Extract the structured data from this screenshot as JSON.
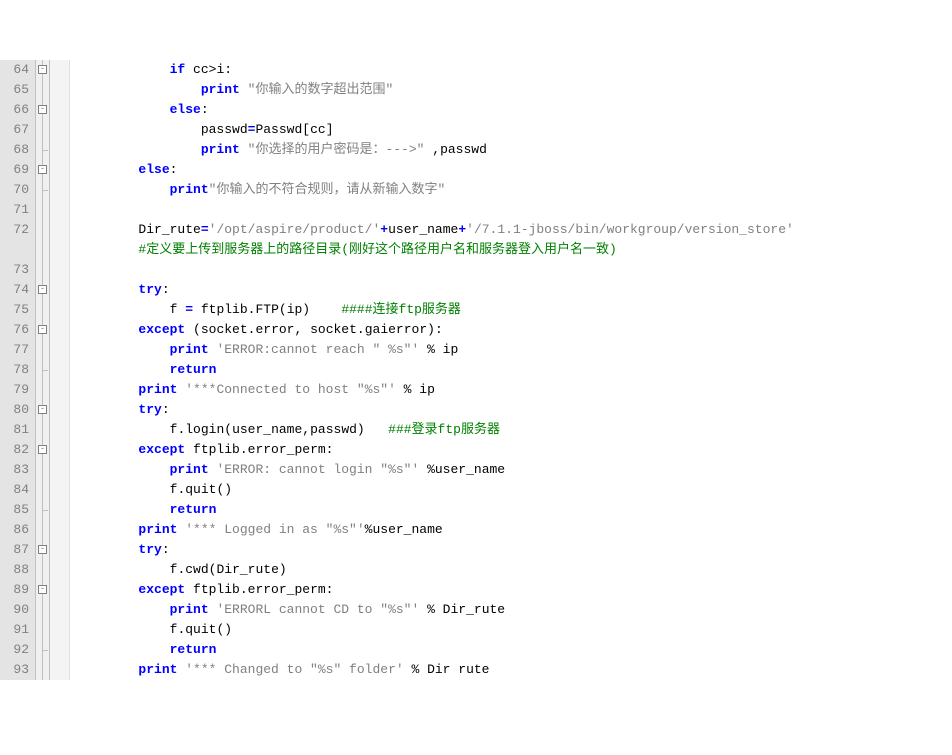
{
  "lines": [
    {
      "num": "64",
      "fold": "start",
      "indent": "            ",
      "tokens": [
        {
          "t": "if ",
          "c": "kw"
        },
        {
          "t": "cc",
          "c": "ident"
        },
        {
          "t": ">",
          "c": "ident"
        },
        {
          "t": "i",
          "c": "ident"
        },
        {
          "t": ":",
          "c": "ident"
        }
      ]
    },
    {
      "num": "65",
      "fold": "line",
      "indent": "                ",
      "tokens": [
        {
          "t": "print ",
          "c": "kw"
        },
        {
          "t": "\"你输入的数字超出范围\"",
          "c": "str"
        }
      ]
    },
    {
      "num": "66",
      "fold": "start",
      "indent": "            ",
      "tokens": [
        {
          "t": "else",
          "c": "kw"
        },
        {
          "t": ":",
          "c": "ident"
        }
      ]
    },
    {
      "num": "67",
      "fold": "line",
      "indent": "                ",
      "tokens": [
        {
          "t": "passwd",
          "c": "ident"
        },
        {
          "t": "=",
          "c": "kw"
        },
        {
          "t": "Passwd",
          "c": "ident"
        },
        {
          "t": "[",
          "c": "ident"
        },
        {
          "t": "cc",
          "c": "ident"
        },
        {
          "t": "]",
          "c": "ident"
        }
      ]
    },
    {
      "num": "68",
      "fold": "end",
      "indent": "                ",
      "tokens": [
        {
          "t": "print ",
          "c": "kw"
        },
        {
          "t": "\"你选择的用户密码是：--->\" ",
          "c": "str"
        },
        {
          "t": ",",
          "c": "ident"
        },
        {
          "t": "passwd",
          "c": "ident"
        }
      ]
    },
    {
      "num": "69",
      "fold": "start",
      "indent": "        ",
      "tokens": [
        {
          "t": "else",
          "c": "kw"
        },
        {
          "t": ":",
          "c": "ident"
        }
      ]
    },
    {
      "num": "70",
      "fold": "end",
      "indent": "            ",
      "tokens": [
        {
          "t": "print",
          "c": "kw"
        },
        {
          "t": "\"你输入的不符合规则，请从新输入数字\"",
          "c": "str"
        }
      ]
    },
    {
      "num": "71",
      "fold": "line",
      "indent": "",
      "tokens": []
    },
    {
      "num": "72",
      "fold": "line",
      "indent": "        ",
      "tokens": [
        {
          "t": "Dir_rute",
          "c": "ident"
        },
        {
          "t": "=",
          "c": "kw"
        },
        {
          "t": "'/opt/aspire/product/'",
          "c": "str"
        },
        {
          "t": "+",
          "c": "kw"
        },
        {
          "t": "user_name",
          "c": "ident"
        },
        {
          "t": "+",
          "c": "kw"
        },
        {
          "t": "'/7.1.1-jboss/bin/workgroup/version_store'",
          "c": "str"
        }
      ]
    },
    {
      "num": "",
      "fold": "line",
      "indent": "        ",
      "tokens": [
        {
          "t": "#定义要上传到服务器上的路径目录(刚好这个路径用户名和服务器登入用户名一致)",
          "c": "comment"
        }
      ]
    },
    {
      "num": "73",
      "fold": "line",
      "indent": "",
      "tokens": []
    },
    {
      "num": "74",
      "fold": "start",
      "indent": "        ",
      "tokens": [
        {
          "t": "try",
          "c": "kw"
        },
        {
          "t": ":",
          "c": "ident"
        }
      ]
    },
    {
      "num": "75",
      "fold": "line",
      "indent": "            ",
      "tokens": [
        {
          "t": "f ",
          "c": "ident"
        },
        {
          "t": "=",
          "c": "kw"
        },
        {
          "t": " ftplib",
          "c": "ident"
        },
        {
          "t": ".",
          "c": "ident"
        },
        {
          "t": "FTP",
          "c": "ident"
        },
        {
          "t": "(",
          "c": "ident"
        },
        {
          "t": "ip",
          "c": "ident"
        },
        {
          "t": ")",
          "c": "ident"
        },
        {
          "t": "    ",
          "c": "ident"
        },
        {
          "t": "####连接ftp服务器",
          "c": "comment"
        }
      ]
    },
    {
      "num": "76",
      "fold": "start",
      "indent": "        ",
      "tokens": [
        {
          "t": "except ",
          "c": "kw"
        },
        {
          "t": "(",
          "c": "ident"
        },
        {
          "t": "socket",
          "c": "ident"
        },
        {
          "t": ".",
          "c": "ident"
        },
        {
          "t": "error",
          "c": "ident"
        },
        {
          "t": ",",
          "c": "ident"
        },
        {
          "t": " socket",
          "c": "ident"
        },
        {
          "t": ".",
          "c": "ident"
        },
        {
          "t": "gaierror",
          "c": "ident"
        },
        {
          "t": ")",
          "c": "ident"
        },
        {
          "t": ":",
          "c": "ident"
        }
      ]
    },
    {
      "num": "77",
      "fold": "line",
      "indent": "            ",
      "tokens": [
        {
          "t": "print ",
          "c": "kw"
        },
        {
          "t": "'ERROR:cannot reach \" %s\"'",
          "c": "str"
        },
        {
          "t": " % ip",
          "c": "ident"
        }
      ]
    },
    {
      "num": "78",
      "fold": "end",
      "indent": "            ",
      "tokens": [
        {
          "t": "return",
          "c": "kw"
        }
      ]
    },
    {
      "num": "79",
      "fold": "line",
      "indent": "        ",
      "tokens": [
        {
          "t": "print ",
          "c": "kw"
        },
        {
          "t": "'***Connected to host \"%s\"'",
          "c": "str"
        },
        {
          "t": " % ip",
          "c": "ident"
        }
      ]
    },
    {
      "num": "80",
      "fold": "start",
      "indent": "        ",
      "tokens": [
        {
          "t": "try",
          "c": "kw"
        },
        {
          "t": ":",
          "c": "ident"
        }
      ]
    },
    {
      "num": "81",
      "fold": "line",
      "indent": "            ",
      "tokens": [
        {
          "t": "f",
          "c": "ident"
        },
        {
          "t": ".",
          "c": "ident"
        },
        {
          "t": "login",
          "c": "ident"
        },
        {
          "t": "(",
          "c": "ident"
        },
        {
          "t": "user_name",
          "c": "ident"
        },
        {
          "t": ",",
          "c": "ident"
        },
        {
          "t": "passwd",
          "c": "ident"
        },
        {
          "t": ")",
          "c": "ident"
        },
        {
          "t": "   ",
          "c": "ident"
        },
        {
          "t": "###登录ftp服务器",
          "c": "comment"
        }
      ]
    },
    {
      "num": "82",
      "fold": "start",
      "indent": "        ",
      "tokens": [
        {
          "t": "except ",
          "c": "kw"
        },
        {
          "t": "ftplib",
          "c": "ident"
        },
        {
          "t": ".",
          "c": "ident"
        },
        {
          "t": "error_perm",
          "c": "ident"
        },
        {
          "t": ":",
          "c": "ident"
        }
      ]
    },
    {
      "num": "83",
      "fold": "line",
      "indent": "            ",
      "tokens": [
        {
          "t": "print ",
          "c": "kw"
        },
        {
          "t": "'ERROR: cannot login \"%s\"'",
          "c": "str"
        },
        {
          "t": " %user_name",
          "c": "ident"
        }
      ]
    },
    {
      "num": "84",
      "fold": "line",
      "indent": "            ",
      "tokens": [
        {
          "t": "f",
          "c": "ident"
        },
        {
          "t": ".",
          "c": "ident"
        },
        {
          "t": "quit",
          "c": "ident"
        },
        {
          "t": "()",
          "c": "ident"
        }
      ]
    },
    {
      "num": "85",
      "fold": "end",
      "indent": "            ",
      "tokens": [
        {
          "t": "return",
          "c": "kw"
        }
      ]
    },
    {
      "num": "86",
      "fold": "line",
      "indent": "        ",
      "tokens": [
        {
          "t": "print ",
          "c": "kw"
        },
        {
          "t": "'*** Logged in as \"%s\"'",
          "c": "str"
        },
        {
          "t": "%user_name",
          "c": "ident"
        }
      ]
    },
    {
      "num": "87",
      "fold": "start",
      "indent": "        ",
      "tokens": [
        {
          "t": "try",
          "c": "kw"
        },
        {
          "t": ":",
          "c": "ident"
        }
      ]
    },
    {
      "num": "88",
      "fold": "line",
      "indent": "            ",
      "tokens": [
        {
          "t": "f",
          "c": "ident"
        },
        {
          "t": ".",
          "c": "ident"
        },
        {
          "t": "cwd",
          "c": "ident"
        },
        {
          "t": "(",
          "c": "ident"
        },
        {
          "t": "Dir_rute",
          "c": "ident"
        },
        {
          "t": ")",
          "c": "ident"
        }
      ]
    },
    {
      "num": "89",
      "fold": "start",
      "indent": "        ",
      "tokens": [
        {
          "t": "except ",
          "c": "kw"
        },
        {
          "t": "ftplib",
          "c": "ident"
        },
        {
          "t": ".",
          "c": "ident"
        },
        {
          "t": "error_perm",
          "c": "ident"
        },
        {
          "t": ":",
          "c": "ident"
        }
      ]
    },
    {
      "num": "90",
      "fold": "line",
      "indent": "            ",
      "tokens": [
        {
          "t": "print ",
          "c": "kw"
        },
        {
          "t": "'ERRORL cannot CD to \"%s\"'",
          "c": "str"
        },
        {
          "t": " % Dir_rute",
          "c": "ident"
        }
      ]
    },
    {
      "num": "91",
      "fold": "line",
      "indent": "            ",
      "tokens": [
        {
          "t": "f",
          "c": "ident"
        },
        {
          "t": ".",
          "c": "ident"
        },
        {
          "t": "quit",
          "c": "ident"
        },
        {
          "t": "()",
          "c": "ident"
        }
      ]
    },
    {
      "num": "92",
      "fold": "end",
      "indent": "            ",
      "tokens": [
        {
          "t": "return",
          "c": "kw"
        }
      ]
    },
    {
      "num": "93",
      "fold": "line",
      "indent": "        ",
      "tokens": [
        {
          "t": "print ",
          "c": "kw"
        },
        {
          "t": "'*** Changed to \"%s\" folder'",
          "c": "str"
        },
        {
          "t": " % Dir rute",
          "c": "ident"
        }
      ]
    }
  ]
}
